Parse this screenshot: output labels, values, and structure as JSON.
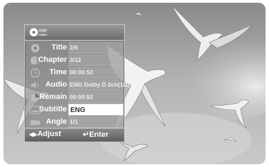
{
  "osd": {
    "logo": {
      "line1": "DVD",
      "line2": "VIDEO"
    },
    "rows": [
      {
        "label": "Title",
        "value": "2/6",
        "icon": "title-disc-icon",
        "selected": false
      },
      {
        "label": "Chapter",
        "value": "3/12",
        "icon": "chapter-icon",
        "selected": false
      },
      {
        "label": "Time",
        "value": "00:00:52",
        "icon": "clock-icon",
        "selected": false
      },
      {
        "label": "Audio",
        "value": "ENG Dolby D 2ch(1/1)",
        "icon": "speaker-icon",
        "selected": false
      },
      {
        "label": "Remain",
        "value": "00:00:52",
        "icon": "remain-disc-icon",
        "selected": false
      },
      {
        "label": "Subtitle",
        "value": "ENG",
        "icon": "subtitle-icon",
        "selected": true
      },
      {
        "label": "Angle",
        "value": "1/1",
        "icon": "camera-angle-icon",
        "selected": false
      }
    ],
    "footer": {
      "adjust_label": "Adjust",
      "enter_label": "Enter"
    }
  }
}
